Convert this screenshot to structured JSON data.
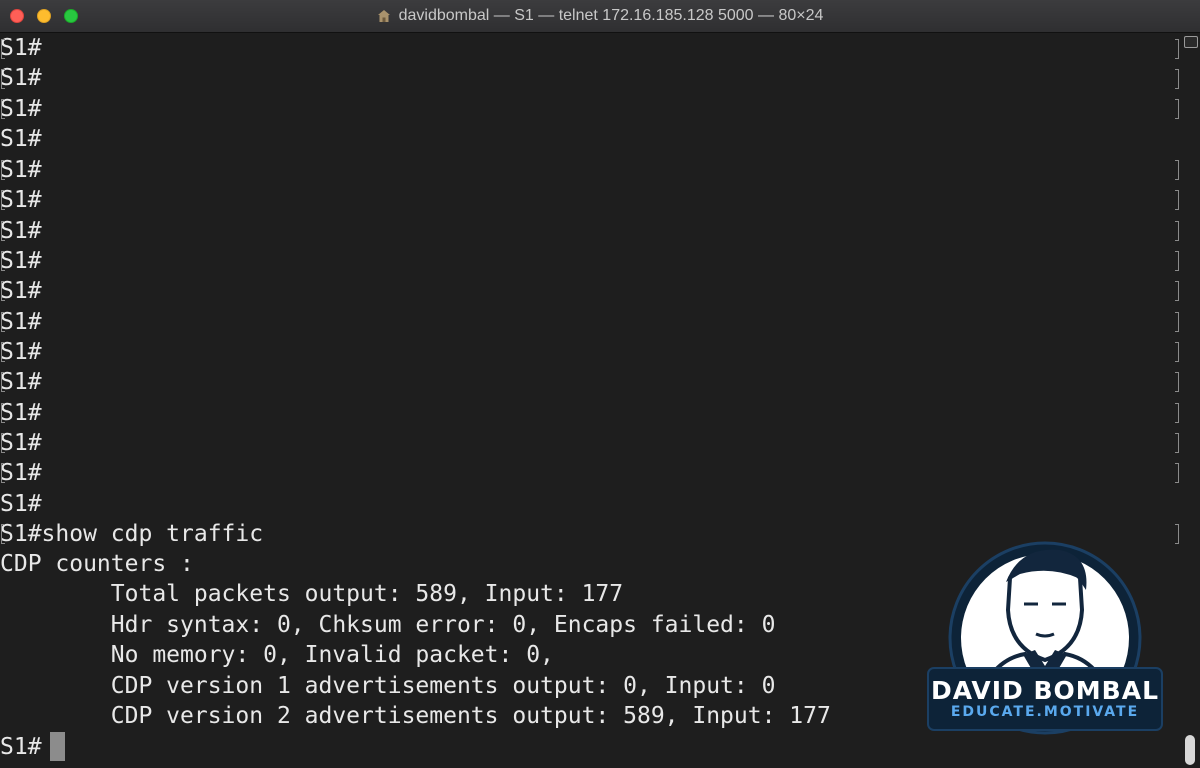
{
  "window": {
    "title": "davidbombal — S1 — telnet 172.16.185.128 5000 — 80×24",
    "title_icon": "home-folder-icon"
  },
  "terminal": {
    "lines": [
      "S1#",
      "S1#",
      "S1#",
      "S1#",
      "S1#",
      "S1#",
      "S1#",
      "S1#",
      "S1#",
      "S1#",
      "S1#",
      "S1#",
      "S1#",
      "S1#",
      "S1#",
      "S1#",
      "S1#show cdp traffic",
      "CDP counters :",
      "        Total packets output: 589, Input: 177",
      "        Hdr syntax: 0, Chksum error: 0, Encaps failed: 0",
      "        No memory: 0, Invalid packet: 0,",
      "        CDP version 1 advertisements output: 0, Input: 0",
      "        CDP version 2 advertisements output: 589, Input: 177",
      "S1#"
    ],
    "text_color": "#e8e8e8",
    "background": "#1e1e1e"
  },
  "logo": {
    "name": "DAVID BOMBAL",
    "tagline": "EDUCATE.MOTIVATE",
    "accent": "#5aa9ee"
  }
}
